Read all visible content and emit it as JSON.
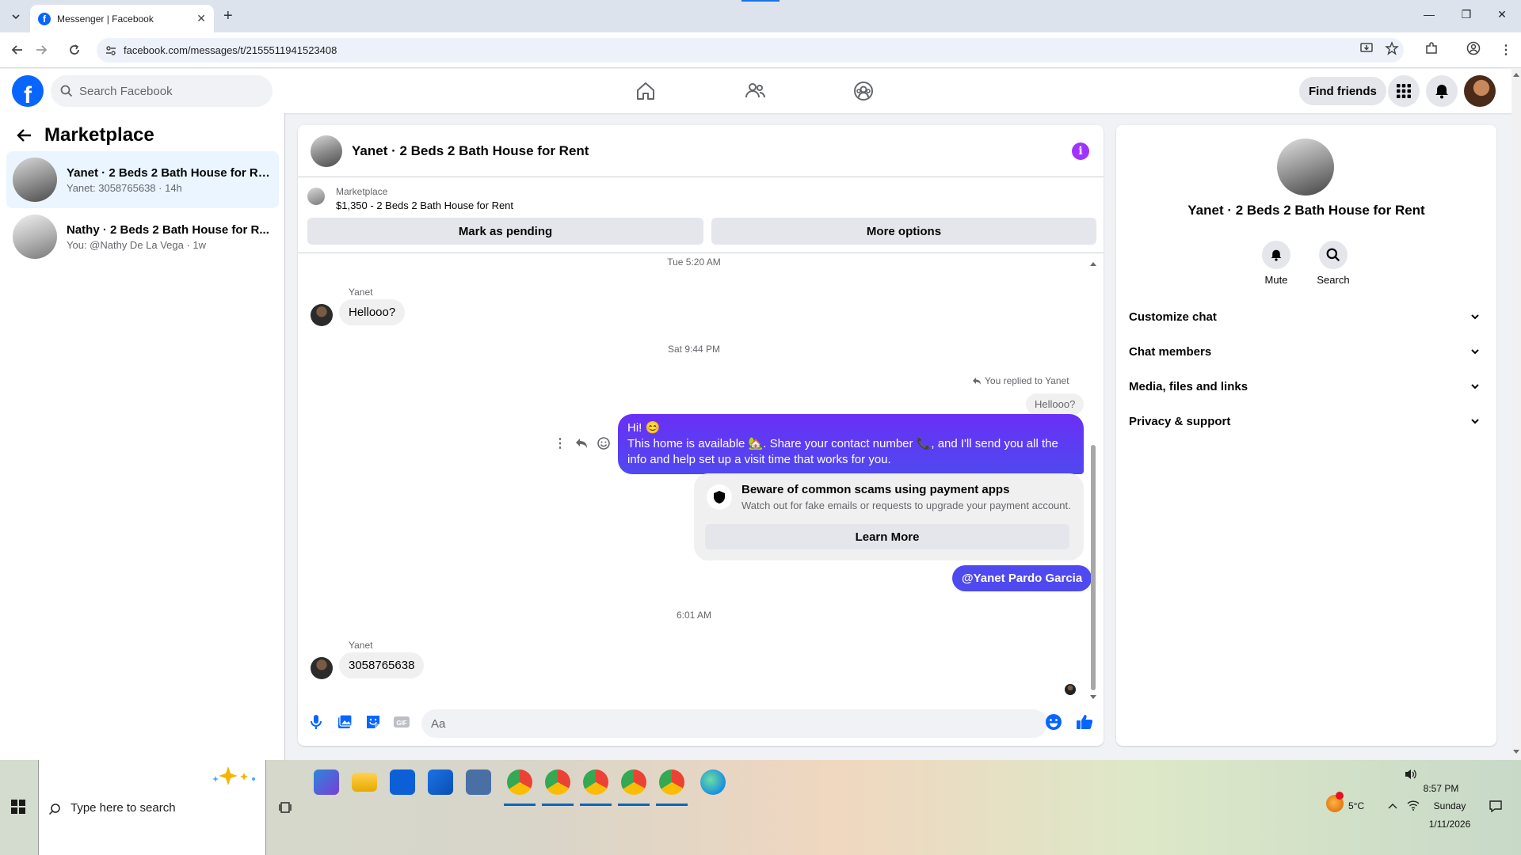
{
  "browser": {
    "tab_title": "Messenger | Facebook",
    "url": "facebook.com/messages/t/2155511941523408"
  },
  "header": {
    "search_placeholder": "Search Facebook",
    "find_friends": "Find friends"
  },
  "sidebar": {
    "title": "Marketplace",
    "conversations": [
      {
        "name": "Yanet · 2 Beds 2 Bath House for Rent",
        "preview": "Yanet: 3058765638 · 14h",
        "active": true
      },
      {
        "name": "Nathy · 2 Beds 2 Bath House for R...",
        "preview": "You: @Nathy De La Vega · 1w",
        "active": false
      }
    ]
  },
  "chat": {
    "title": "Yanet · 2 Beds 2 Bath House for Rent",
    "marketplace_label": "Marketplace",
    "listing": "$1,350 - 2 Beds 2 Bath House for Rent",
    "mark_pending": "Mark as pending",
    "more_options": "More options",
    "messages": {
      "ts1": "Tue 5:20 AM",
      "sender1": "Yanet",
      "msg1": "Hellooo?",
      "ts2": "Sat 9:44 PM",
      "replied_to": "You replied to Yanet",
      "reply_quote": "Hellooo?",
      "out_line1": "Hi! 😊",
      "out_line2": "This home is available 🏡. Share your contact number 📞, and I'll send you all the",
      "out_line3": "info and help set up a visit time that works for you.",
      "scam_title": "Beware of common scams using payment apps",
      "scam_sub": "Watch out for fake emails or requests to upgrade your payment account.",
      "learn_more": "Learn More",
      "mention": "@Yanet Pardo Garcia",
      "ts3": "6:01 AM",
      "sender2": "Yanet",
      "msg2": "3058765638"
    },
    "composer_placeholder": "Aa"
  },
  "info": {
    "name": "Yanet · 2 Beds 2 Bath House for Rent",
    "mute": "Mute",
    "search": "Search",
    "sections": [
      "Customize chat",
      "Chat members",
      "Media, files and links",
      "Privacy & support"
    ]
  },
  "taskbar": {
    "search_placeholder": "Type here to search",
    "temperature": "5°C",
    "time": "8:57 PM",
    "day": "Sunday",
    "date": "1/11/2026"
  },
  "colors": {
    "fb_blue": "#0866ff",
    "outgoing_bubble": "#5b3cf2",
    "info_purple": "#a033ff"
  }
}
